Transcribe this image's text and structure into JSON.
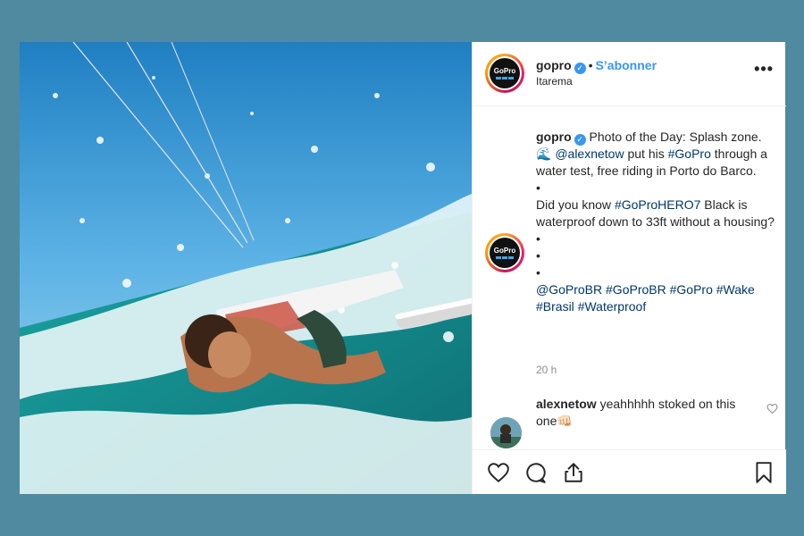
{
  "post": {
    "username": "gopro",
    "follow_label": "S’abonner",
    "separator": "•",
    "location": "Itarema",
    "more_label": "•••",
    "avatar_logo": "GoPro"
  },
  "caption": {
    "username": "gopro",
    "line1_a": " Photo of the Day: Splash zone. 🌊 ",
    "mention1": "@alexnetow",
    "line1_b": " put his ",
    "hashtag1": "#GoPro",
    "line1_c": " through a water test, free riding in Porto do Barco.",
    "bullet": "•",
    "line2_a": "Did you know ",
    "hashtag2": "#GoProHERO7",
    "line2_b": " Black is waterproof down to 33ft without a housing?",
    "tags": [
      "@GoProBR",
      "#GoProBR",
      "#GoPro",
      "#Wake",
      "#Brasil",
      "#Waterproof"
    ]
  },
  "timestamp": "20 h",
  "comment": {
    "username": "alexnetow",
    "text": " yeahhhhh stoked on this one👊🏻"
  },
  "colors": {
    "background": "#4f8aa0",
    "accent": "#3897f0",
    "link": "#00376b"
  },
  "icons": [
    "verified-icon",
    "more-icon",
    "heart-icon",
    "comment-icon",
    "share-icon",
    "bookmark-icon"
  ]
}
